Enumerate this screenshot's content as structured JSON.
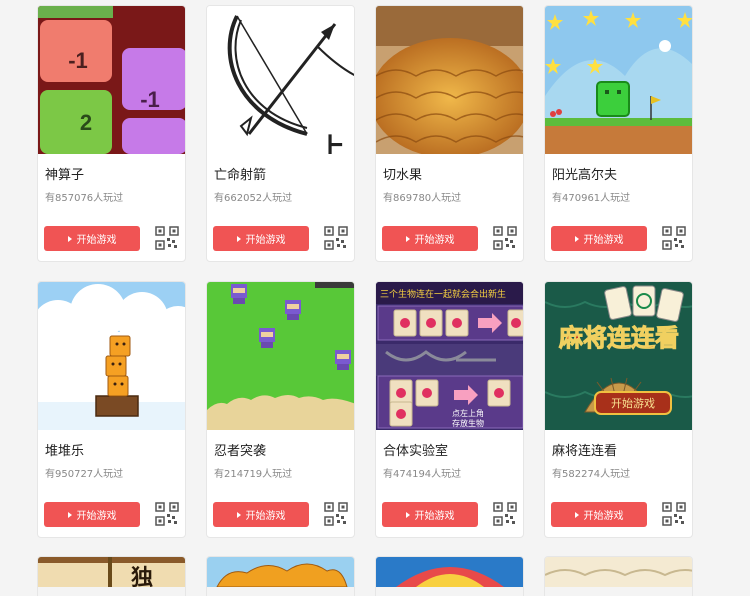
{
  "games": [
    {
      "title": "神算子",
      "plays": "有857076人玩过",
      "button": "开始游戏"
    },
    {
      "title": "亡命射箭",
      "plays": "有662052人玩过",
      "button": "开始游戏"
    },
    {
      "title": "切水果",
      "plays": "有869780人玩过",
      "button": "开始游戏"
    },
    {
      "title": "阳光高尔夫",
      "plays": "有470961人玩过",
      "button": "开始游戏"
    },
    {
      "title": "堆堆乐",
      "plays": "有950727人玩过",
      "button": "开始游戏"
    },
    {
      "title": "忍者突袭",
      "plays": "有214719人玩过",
      "button": "开始游戏"
    },
    {
      "title": "合体实验室",
      "plays": "有474194人玩过",
      "button": "开始游戏"
    },
    {
      "title": "麻将连连看",
      "plays": "有582274人玩过",
      "button": "开始游戏"
    }
  ],
  "thumb_text": {
    "math_minus1_a": "-1",
    "math_minus1_b": "-1",
    "math_two": "2",
    "archery_char": "上",
    "lab_banner": "三个生物连在一起就会合出新生",
    "lab_hint1": "点左上角",
    "lab_hint2": "存放生物",
    "mahjong_title": "麻将连连看",
    "mahjong_start": "开始游戏",
    "partial_1": "独"
  },
  "colors": {
    "button": "#f05454",
    "card_border": "#e6e6e6"
  }
}
